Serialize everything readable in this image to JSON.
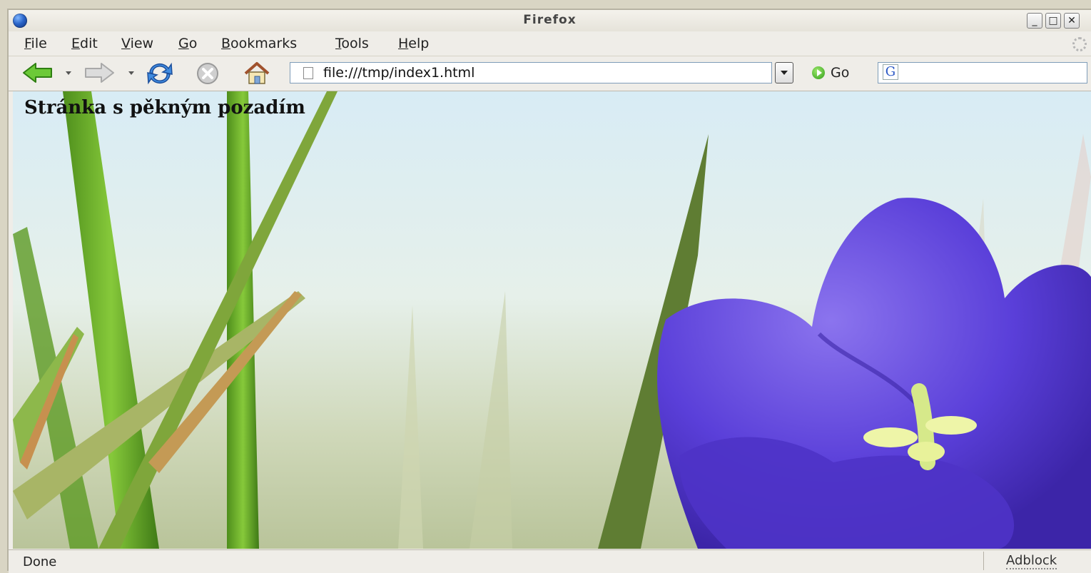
{
  "window": {
    "title": "Firefox",
    "controls": {
      "minimize": "_",
      "maximize": "□",
      "close": "✕"
    }
  },
  "menu": [
    "File",
    "Edit",
    "View",
    "Go",
    "Bookmarks",
    "Tools",
    "Help"
  ],
  "toolbar": {
    "url": "file:///tmp/index1.html",
    "go_label": "Go",
    "search_engine_icon": "G"
  },
  "page": {
    "heading": "Stránka s pěkným pozadím"
  },
  "status": {
    "text": "Done",
    "addon": "Adblock"
  },
  "icons": {
    "back": "back-arrow-icon",
    "forward": "forward-arrow-icon",
    "reload": "reload-icon",
    "stop": "stop-icon",
    "home": "home-icon",
    "page": "page-icon",
    "throbber": "throbber-icon"
  },
  "colors": {
    "back_arrow": "#5fbf2c",
    "reload": "#3a7fd6",
    "flower": "#6a4fe0",
    "grass": "#6fae2a",
    "sky": "#dcecf4"
  }
}
